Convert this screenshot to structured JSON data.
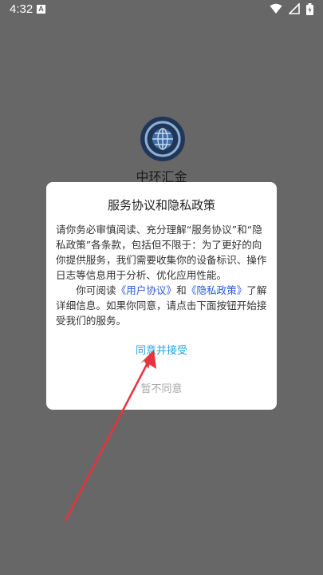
{
  "status_bar": {
    "time": "4:32",
    "notification_letter": "A"
  },
  "app": {
    "name": "中环汇金"
  },
  "dialog": {
    "title": "服务协议和隐私政策",
    "para1": "请你务必审慎阅读、充分理解“服务协议”和“隐私政策”各条款，包括但不限于：为了更好的向你提供服务，我们需要收集你的设备标识、操作日志等信息用于分析、优化应用性能。",
    "para2_prefix": "你可阅读",
    "user_agreement_link": "《用户协议》",
    "para2_and": "和",
    "privacy_policy_link": "《隐私政策》",
    "para2_suffix": "了解详细信息。如果你同意，请点击下面按钮开始接受我们的服务。",
    "agree_label": "同意并接受",
    "disagree_label": "暂不同意"
  },
  "colors": {
    "overlay": "#676767",
    "agree": "#21a9df",
    "disagree": "#a8a8a8",
    "link": "#2a5bd7",
    "annotation_arrow": "#e8323c"
  }
}
